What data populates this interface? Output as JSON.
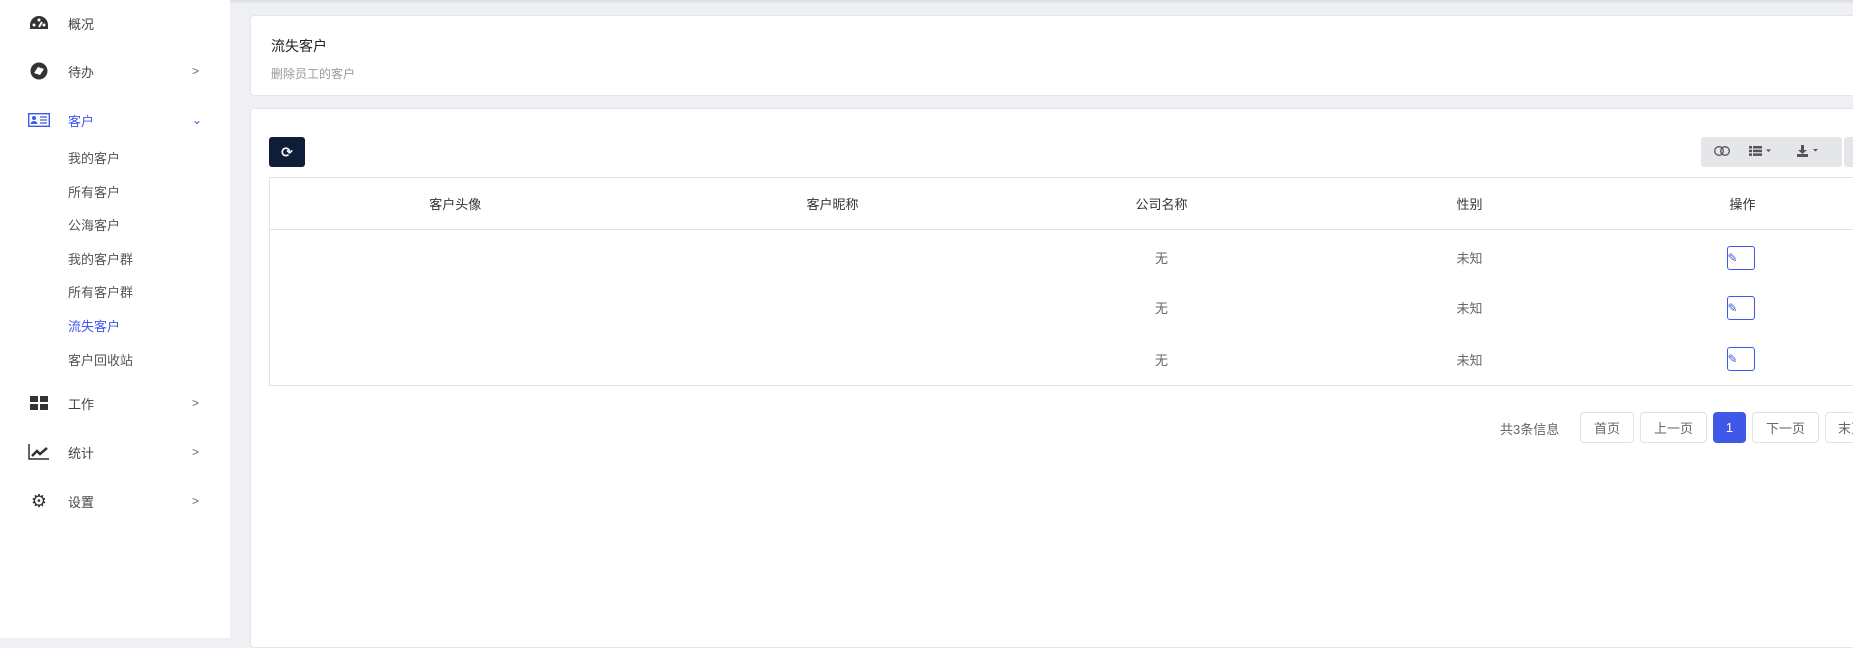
{
  "sidebar": {
    "items": [
      {
        "label": "概况",
        "icon": "dashboard-icon"
      },
      {
        "label": "待办",
        "icon": "compass-icon"
      },
      {
        "label": "客户",
        "icon": "id-card-icon"
      },
      {
        "label": "工作",
        "icon": "grid-icon"
      },
      {
        "label": "统计",
        "icon": "line-chart-icon"
      },
      {
        "label": "设置",
        "icon": "gear-icon"
      }
    ],
    "sub_items": [
      "我的客户",
      "所有客户",
      "公海客户",
      "我的客户群",
      "所有客户群",
      "流失客户",
      "客户回收站"
    ]
  },
  "header": {
    "title": "流失客户",
    "subtitle": "删除员工的客户"
  },
  "table": {
    "columns": [
      "客户头像",
      "客户昵称",
      "公司名称",
      "性别",
      "操作"
    ],
    "rows": [
      {
        "avatar": "",
        "nickname": "",
        "company": "无",
        "gender": "未知"
      },
      {
        "avatar": "",
        "nickname": "",
        "company": "无",
        "gender": "未知"
      },
      {
        "avatar": "",
        "nickname": "",
        "company": "无",
        "gender": "未知"
      }
    ]
  },
  "pagination": {
    "info": "共3条信息",
    "first": "首页",
    "prev": "上一页",
    "current": "1",
    "next": "下一页",
    "last": "末页"
  },
  "colors": {
    "accent": "#4058e8",
    "dark": "#0e1e38"
  }
}
